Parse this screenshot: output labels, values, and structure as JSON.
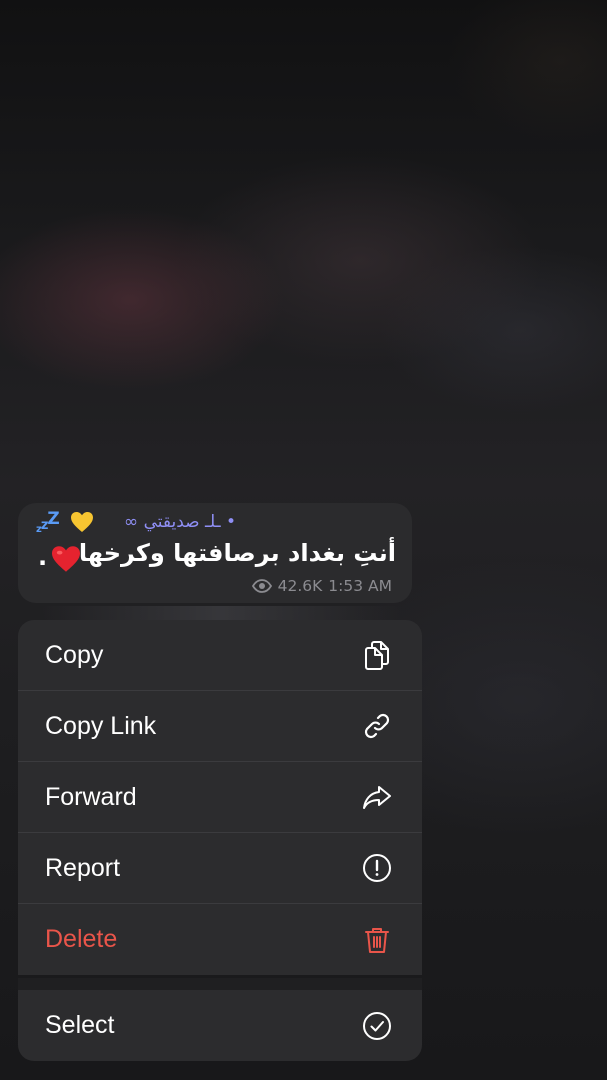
{
  "message": {
    "caption": "• ـلـ صديقتي ∞",
    "sleep_emoji": "zzZ",
    "text": "أنتِ بغداد برصافتها وكرخها",
    "trailing_period": ".",
    "views": "42.6K",
    "time": "1:53 AM",
    "colors": {
      "caption": "#8f8ff5",
      "bubble": "#2b2b2d"
    }
  },
  "menu": {
    "items": [
      {
        "label": "Copy",
        "icon": "copy-icon",
        "danger": false
      },
      {
        "label": "Copy Link",
        "icon": "link-icon",
        "danger": false
      },
      {
        "label": "Forward",
        "icon": "forward-icon",
        "danger": false
      },
      {
        "label": "Report",
        "icon": "report-icon",
        "danger": false
      },
      {
        "label": "Delete",
        "icon": "trash-icon",
        "danger": true
      }
    ],
    "secondary": [
      {
        "label": "Select",
        "icon": "check-circle-icon",
        "danger": false
      }
    ],
    "colors": {
      "text": "#ffffff",
      "danger": "#e9554a",
      "background": "#2c2c2e"
    }
  }
}
